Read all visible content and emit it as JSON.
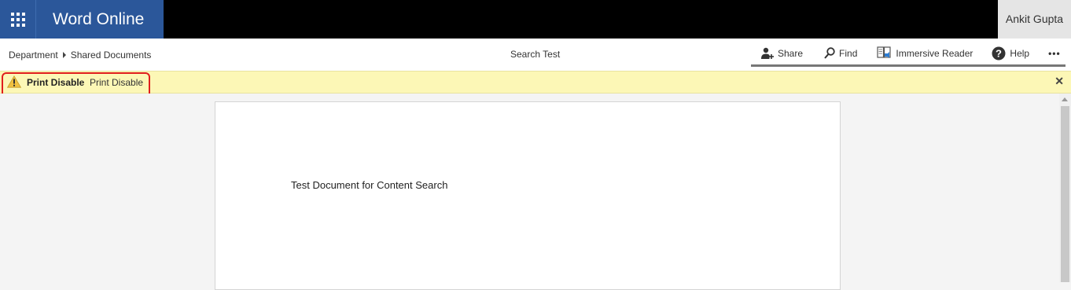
{
  "app": {
    "name": "Word Online"
  },
  "user": {
    "name": "Ankit Gupta"
  },
  "breadcrumb": {
    "items": [
      "Department",
      "Shared Documents"
    ]
  },
  "document": {
    "title": "Search Test",
    "body_text": "Test Document for Content Search"
  },
  "actions": {
    "share": "Share",
    "find": "Find",
    "immersive_reader": "Immersive Reader",
    "help": "Help",
    "more": "•••"
  },
  "message_bar": {
    "title": "Print Disable",
    "text": "Print Disable",
    "close": "✕"
  },
  "colors": {
    "brand": "#2b579a",
    "message_bg": "#fcf7b6",
    "highlight": "#e01e1e"
  },
  "icons": [
    "app-launcher-icon",
    "share-person-icon",
    "search-icon",
    "immersive-reader-icon",
    "help-icon",
    "warning-icon",
    "close-icon"
  ]
}
